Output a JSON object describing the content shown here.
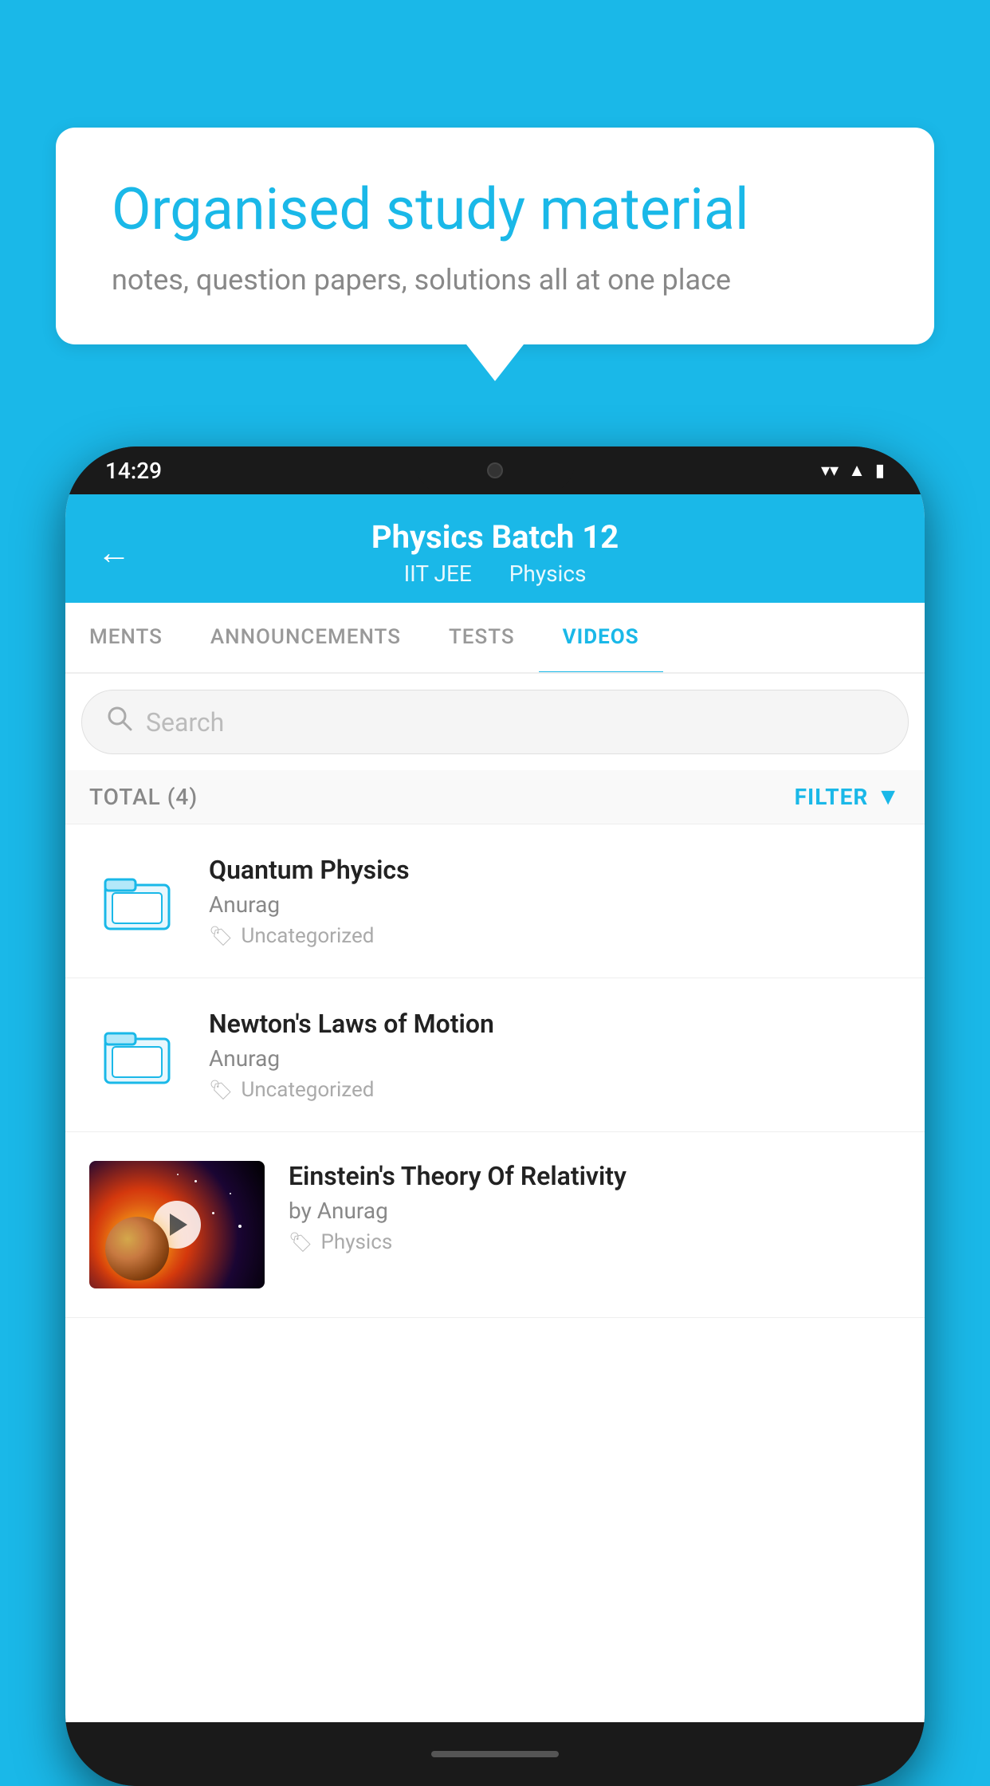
{
  "bubble": {
    "title": "Organised study material",
    "subtitle": "notes, question papers, solutions all at one place"
  },
  "status_bar": {
    "time": "14:29",
    "icons": [
      "wifi",
      "signal",
      "battery"
    ]
  },
  "app_header": {
    "title": "Physics Batch 12",
    "subtitle_part1": "IIT JEE",
    "subtitle_part2": "Physics",
    "back_label": "←"
  },
  "tabs": [
    {
      "label": "MENTS",
      "active": false
    },
    {
      "label": "ANNOUNCEMENTS",
      "active": false
    },
    {
      "label": "TESTS",
      "active": false
    },
    {
      "label": "VIDEOS",
      "active": true
    }
  ],
  "search": {
    "placeholder": "Search"
  },
  "filter_row": {
    "total_label": "TOTAL (4)",
    "filter_label": "FILTER"
  },
  "videos": [
    {
      "title": "Quantum Physics",
      "author": "Anurag",
      "tag": "Uncategorized",
      "has_thumbnail": false
    },
    {
      "title": "Newton's Laws of Motion",
      "author": "Anurag",
      "tag": "Uncategorized",
      "has_thumbnail": false
    },
    {
      "title": "Einstein's Theory Of Relativity",
      "author": "by Anurag",
      "tag": "Physics",
      "has_thumbnail": true
    }
  ],
  "colors": {
    "primary": "#1ab8e8",
    "text_dark": "#222",
    "text_muted": "#888",
    "text_light": "#aaa"
  }
}
